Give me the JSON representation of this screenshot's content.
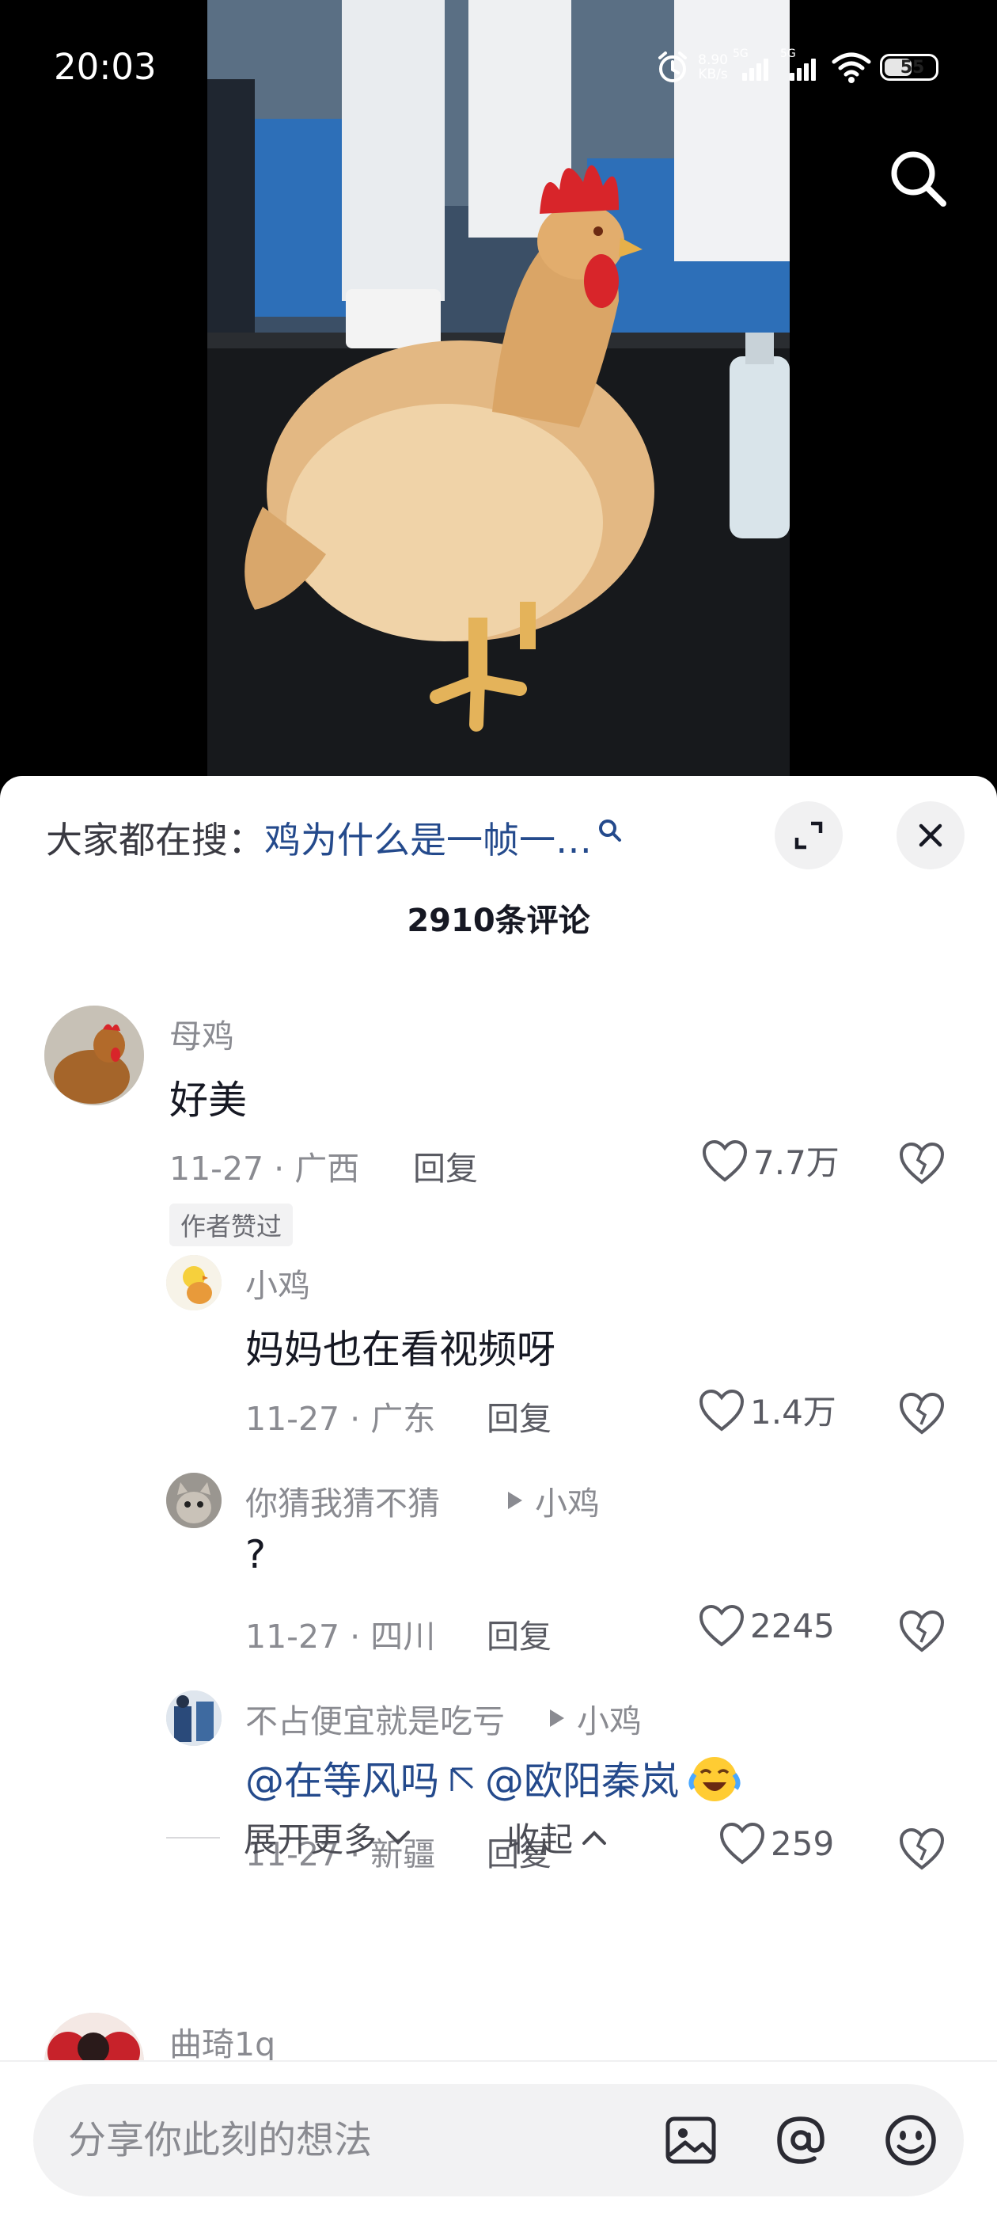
{
  "status_bar": {
    "time": "20:03",
    "net_speed_value": "8.90",
    "net_speed_unit": "KB/s",
    "sim1_label": "5G",
    "sim2_label": "5G",
    "battery": "55"
  },
  "video": {
    "description_icon": "rooster-video-frame"
  },
  "comments_panel": {
    "hot_search_prefix": "大家都在搜：",
    "hot_search_query": "鸡为什么是一帧一…",
    "expand_icon": "fullscreen-icon",
    "close_icon": "close-icon",
    "comment_count_title": "2910条评论"
  },
  "comments": [
    {
      "username": "母鸡",
      "text": "好美",
      "date_location": "11-27 · 广西",
      "reply_label": "回复",
      "likes": "7.7万",
      "author_tag": "作者赞过",
      "replies": [
        {
          "username": "小鸡",
          "text": "妈妈也在看视频呀",
          "date_location": "11-27 · 广东",
          "reply_label": "回复",
          "likes": "1.4万"
        },
        {
          "username": "你猜我猜不猜",
          "reply_to": "小鸡",
          "text": "?",
          "date_location": "11-27 · 四川",
          "reply_label": "回复",
          "likes": "2245"
        },
        {
          "username": "不占便宜就是吃亏",
          "reply_to": "小鸡",
          "mention_1": "@在等风吗",
          "mention_2": "@欧阳秦岚",
          "date_location": "11-27 · 新疆",
          "reply_label": "回复",
          "likes": "259"
        }
      ],
      "expand_more_label": "展开更多",
      "collapse_label": "收起"
    },
    {
      "username": "曲琦1q"
    }
  ],
  "input": {
    "placeholder": "分享你此刻的想法",
    "image_icon": "image-icon",
    "at_icon": "at-icon",
    "emoji_icon": "emoji-icon"
  }
}
